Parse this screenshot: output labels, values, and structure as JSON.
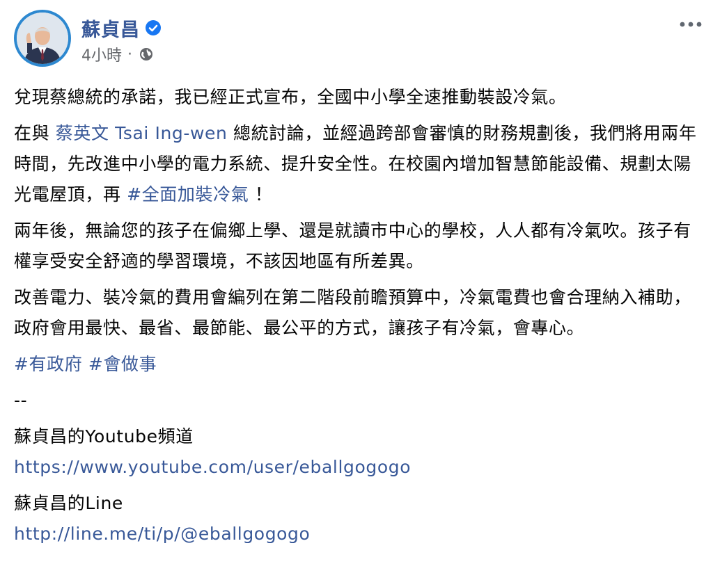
{
  "post": {
    "author": {
      "name": "蘇貞昌",
      "verified": true,
      "verified_icon": "verified-badge-icon",
      "avatar_icon": "profile-photo"
    },
    "meta": {
      "time": "4小時",
      "dot": "·",
      "privacy_icon": "globe-icon"
    },
    "more_icon": "more-options-icon",
    "paragraphs": {
      "p1": "兌現蔡總統的承諾，我已經正式宣布，全國中小學全速推動裝設冷氣。",
      "p2_before": "在與 ",
      "p2_mention": "蔡英文 Tsai Ing-wen",
      "p2_mid": " 總統討論，並經過跨部會審慎的財務規劃後，我們將用兩年時間，先改進中小學的電力系統、提升安全性。在校園內增加智慧節能設備、規劃太陽光電屋頂，再 ",
      "p2_hashtag": "#全面加裝冷氣",
      "p2_after": " ！",
      "p3": "兩年後，無論您的孩子在偏鄉上學、還是就讀市中心的學校，人人都有冷氣吹。孩子有權享受安全舒適的學習環境，不該因地區有所差異。",
      "p4": "改善電力、裝冷氣的費用會編列在第二階段前瞻預算中，冷氣電費也會合理納入補助，政府會用最快、最省、最節能、最公平的方式，讓孩子有冷氣，會專心。",
      "hashtag1": "#有政府",
      "hashtag2": "#會做事",
      "separator": "--",
      "youtube_label": "蘇貞昌的Youtube頻道",
      "youtube_url": "https://www.youtube.com/user/eballgogogo",
      "line_label": "蘇貞昌的Line",
      "line_url": "http://line.me/ti/p/@eballgogogo"
    },
    "colors": {
      "link": "#385898",
      "meta": "#65676b",
      "verified": "#1877f2",
      "text": "#050505"
    }
  }
}
